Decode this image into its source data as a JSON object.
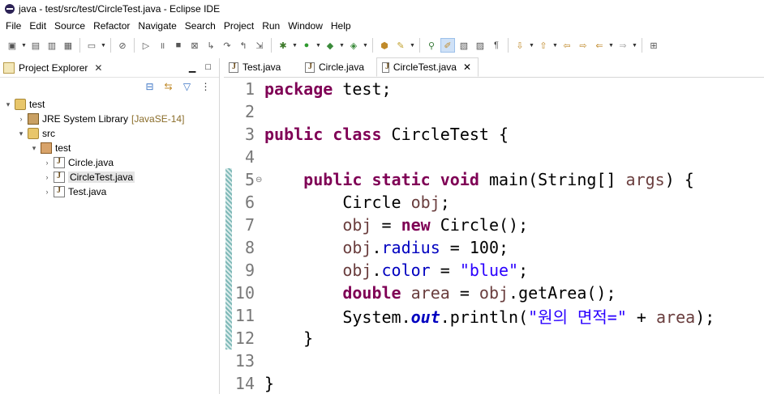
{
  "window": {
    "title": "java - test/src/test/CircleTest.java - Eclipse IDE"
  },
  "menu": [
    "File",
    "Edit",
    "Source",
    "Refactor",
    "Navigate",
    "Search",
    "Project",
    "Run",
    "Window",
    "Help"
  ],
  "explorer": {
    "title": "Project Explorer",
    "tree": {
      "project": "test",
      "library": "JRE System Library",
      "library_version": "[JavaSE-14]",
      "src": "src",
      "package": "test",
      "files": [
        "Circle.java",
        "CircleTest.java",
        "Test.java"
      ]
    }
  },
  "editor": {
    "tabs": [
      "Test.java",
      "Circle.java",
      "CircleTest.java"
    ],
    "line_numbers": [
      "1",
      "2",
      "3",
      "4",
      "5",
      "6",
      "7",
      "8",
      "9",
      "10",
      "11",
      "12",
      "13",
      "14"
    ],
    "code": {
      "l1": {
        "kw": "package",
        "rest": " test;"
      },
      "l3": {
        "kw": "public class",
        "rest": " CircleTest {"
      },
      "l5": {
        "indent": "    ",
        "kw": "public static void",
        "rest": " main(String[] ",
        "var": "args",
        "end": ") {"
      },
      "l6": {
        "indent": "        ",
        "type": "Circle ",
        "var": "obj",
        "end": ";"
      },
      "l7": {
        "indent": "        ",
        "var": "obj",
        "mid": " = ",
        "kw": "new",
        "end": " Circle();"
      },
      "l8": {
        "indent": "        ",
        "var": "obj",
        "dot": ".",
        "field": "radius",
        "end": " = 100;"
      },
      "l9": {
        "indent": "        ",
        "var": "obj",
        "dot": ".",
        "field": "color",
        "mid": " = ",
        "str": "\"blue\"",
        "end": ";"
      },
      "l10": {
        "indent": "        ",
        "kw": "double",
        "sp": " ",
        "var": "area",
        "mid": " = ",
        "var2": "obj",
        "end": ".getArea();"
      },
      "l11": {
        "indent": "        ",
        "cls": "System.",
        "static": "out",
        "mid": ".println(",
        "str": "\"원의 면적=\"",
        "plus": " + ",
        "var": "area",
        "end": ");"
      },
      "l12": {
        "text": "    }"
      },
      "l14": {
        "text": "}"
      }
    }
  }
}
